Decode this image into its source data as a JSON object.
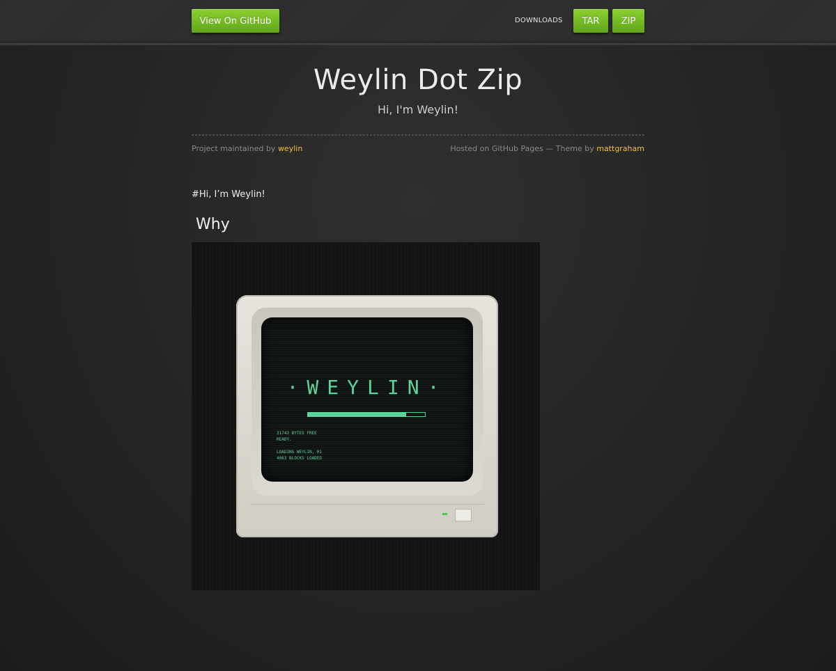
{
  "topbar": {
    "github_label": "View On GitHub",
    "downloads_label": "DOWNLOADS",
    "tar_label": "TAR",
    "zip_label": "ZIP"
  },
  "header": {
    "title": "Weylin Dot Zip",
    "subtitle": "Hi, I'm Weylin!"
  },
  "credits": {
    "maintained_prefix": "Project maintained by ",
    "maintainer": "weylin",
    "hosted_prefix": "Hosted on GitHub Pages — Theme by ",
    "theme_author": "mattgraham"
  },
  "content": {
    "intro": "#Hi, I’m Weylin!",
    "heading": "Why"
  },
  "photo": {
    "screen_logo": "·WEYLIN·",
    "screen_text": "31743 BYTES FREE\nREADY.\n\nLOADING WEYLIN, 01\n4063 BLOCKS LOADED",
    "progress": 0.84
  },
  "colors": {
    "accent": "#74bc24",
    "link": "#f2c13a",
    "screen_green": "#5ed49b"
  }
}
